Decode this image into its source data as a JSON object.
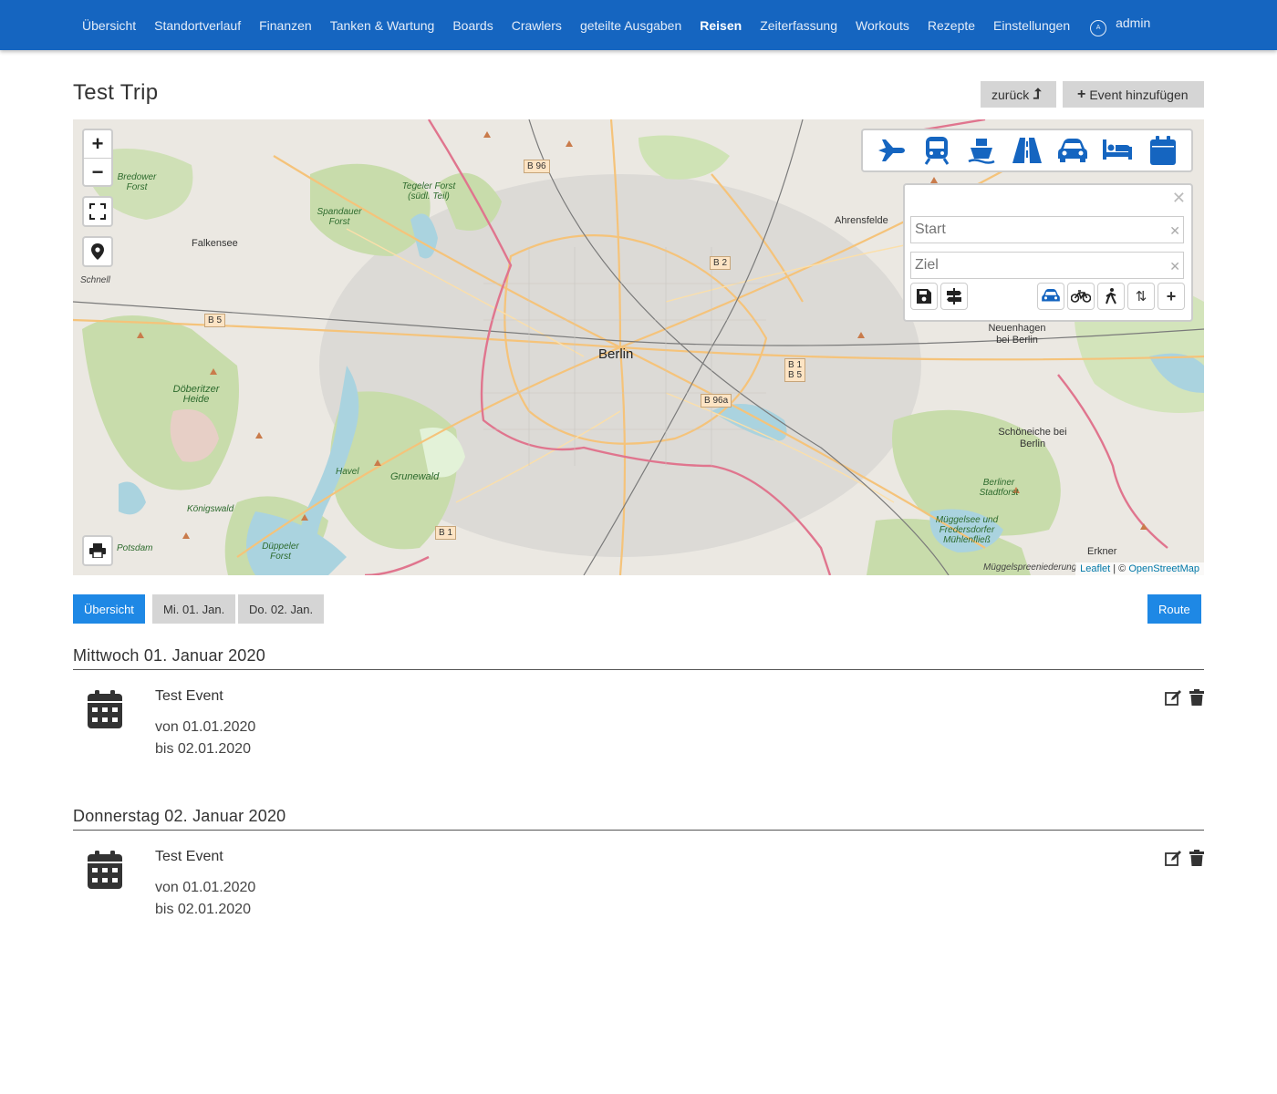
{
  "nav": {
    "items": [
      {
        "label": "Übersicht",
        "active": false
      },
      {
        "label": "Standortverlauf",
        "active": false
      },
      {
        "label": "Finanzen",
        "active": false
      },
      {
        "label": "Tanken & Wartung",
        "active": false
      },
      {
        "label": "Boards",
        "active": false
      },
      {
        "label": "Crawlers",
        "active": false
      },
      {
        "label": "geteilte Ausgaben",
        "active": false
      },
      {
        "label": "Reisen",
        "active": true
      },
      {
        "label": "Zeiterfassung",
        "active": false
      },
      {
        "label": "Workouts",
        "active": false
      },
      {
        "label": "Rezepte",
        "active": false
      },
      {
        "label": "Einstellungen",
        "active": false
      }
    ],
    "user": {
      "label": "admin",
      "icon": "user-circle-icon",
      "icon_letter": "A"
    }
  },
  "header": {
    "title": "Test Trip",
    "back_label": "zurück",
    "add_event_label": "Event hinzufügen"
  },
  "map": {
    "transport_icons": [
      "plane-icon",
      "train-icon",
      "ship-icon",
      "road-icon",
      "car-icon",
      "bed-icon",
      "calendar-icon"
    ],
    "route": {
      "start_placeholder": "Start",
      "end_placeholder": "Ziel",
      "profiles": [
        "car-icon",
        "bicycle-icon",
        "walking-icon"
      ]
    },
    "labels": {
      "city": "Berlin",
      "falkensee": "Falkensee",
      "ahrensfelde": "Ahrensfelde",
      "neuenhagen": "Neuenhagen bei Berlin",
      "schoeneiche": "Schöneiche bei Berlin",
      "erkner": "Erkner",
      "potsdam": "Potsdam",
      "schnell": "Schnell",
      "doeberitzer": "Döberitzer Heide",
      "grunewald": "Grunewald",
      "bredower": "Bredower Forst",
      "spandauer": "Spandauer Forst",
      "tegeler": "Tegeler Forst (südl. Teil)",
      "koenigswald": "Königswald",
      "havel": "Havel",
      "dueppeler": "Düppeler Forst",
      "berliner_stadtforst": "Berliner Stadtforst",
      "mueggelsee": "Müggelsee und Fredersdorfer Mühlenfließ",
      "berlin_river": "Berlin",
      "shields": [
        "B 96",
        "B 2",
        "B 5",
        "B 1",
        "B 5",
        "B 96a",
        "B 1"
      ]
    },
    "attribution": {
      "leaflet": "Leaflet",
      "sep": " | © ",
      "osm": "OpenStreetMap",
      "overlay": "Müggelspreeniederung"
    }
  },
  "tabs": {
    "overview": "Übersicht",
    "day1": "Mi. 01. Jan.",
    "day2": "Do. 02. Jan.",
    "route": "Route"
  },
  "days": [
    {
      "heading": "Mittwoch 01. Januar 2020",
      "event": {
        "title": "Test Event",
        "from": "von 01.01.2020",
        "to": "bis 02.01.2020",
        "icon": "calendar-icon"
      }
    },
    {
      "heading": "Donnerstag 02. Januar 2020",
      "event": {
        "title": "Test Event",
        "from": "von 01.01.2020",
        "to": "bis 02.01.2020",
        "icon": "calendar-icon"
      }
    }
  ],
  "colors": {
    "navbar": "#1565c0",
    "primary": "#1e88e5",
    "icon_blue": "#1565c0"
  }
}
